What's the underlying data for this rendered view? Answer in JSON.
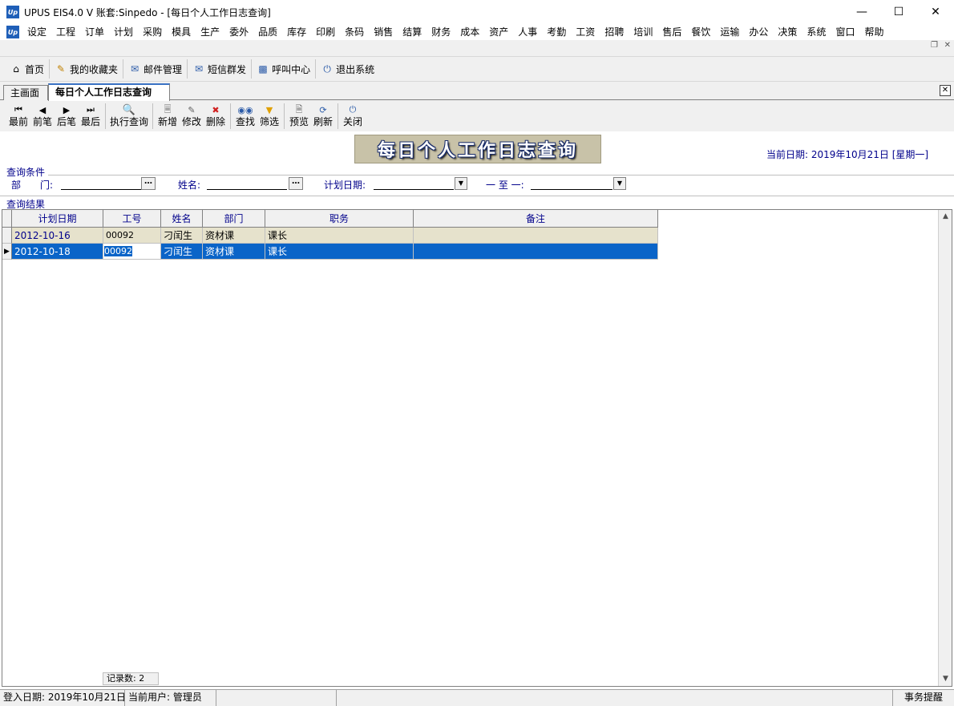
{
  "window": {
    "title": "UPUS EIS4.0 V 账套:Sinpedo - [每日个人工作日志查询]",
    "app_icon_text": "Up"
  },
  "menu": [
    "设定",
    "工程",
    "订单",
    "计划",
    "采购",
    "模具",
    "生产",
    "委外",
    "品质",
    "库存",
    "印刷",
    "条码",
    "销售",
    "结算",
    "财务",
    "成本",
    "资产",
    "人事",
    "考勤",
    "工资",
    "招聘",
    "培训",
    "售后",
    "餐饮",
    "运输",
    "办公",
    "决策",
    "系统",
    "窗口",
    "帮助"
  ],
  "quickbar": [
    {
      "label": "首页",
      "icon": "home-icon"
    },
    {
      "label": "我的收藏夹",
      "icon": "favorites-icon"
    },
    {
      "label": "邮件管理",
      "icon": "mail-icon"
    },
    {
      "label": "短信群发",
      "icon": "sms-icon"
    },
    {
      "label": "呼叫中心",
      "icon": "chat-icon"
    },
    {
      "label": "退出系统",
      "icon": "power-icon"
    }
  ],
  "tabs": [
    {
      "label": "主画面",
      "active": false
    },
    {
      "label": "每日个人工作日志查询",
      "active": true
    }
  ],
  "toolbar": [
    {
      "label": "最前",
      "icon": "first-icon"
    },
    {
      "label": "前笔",
      "icon": "prev-icon"
    },
    {
      "label": "后笔",
      "icon": "next-icon"
    },
    {
      "label": "最后",
      "icon": "last-icon"
    },
    {
      "label": "执行查询",
      "icon": "search-icon"
    },
    {
      "label": "新增",
      "icon": "new-icon"
    },
    {
      "label": "修改",
      "icon": "edit-icon"
    },
    {
      "label": "删除",
      "icon": "delete-icon"
    },
    {
      "label": "查找",
      "icon": "binoculars-icon"
    },
    {
      "label": "筛选",
      "icon": "filter-icon"
    },
    {
      "label": "预览",
      "icon": "preview-icon"
    },
    {
      "label": "刷新",
      "icon": "refresh-icon"
    },
    {
      "label": "关闭",
      "icon": "power-icon"
    }
  ],
  "page": {
    "title": "每日个人工作日志查询",
    "current_date_label": "当前日期: 2019年10月21日 [星期一]"
  },
  "query": {
    "group_label": "查询条件",
    "dept_label": "部　　门:",
    "dept_value": "",
    "name_label": "姓名:",
    "name_value": "",
    "plan_date_label": "计划日期:",
    "plan_date_from": "",
    "to_label": "一 至 一:",
    "plan_date_to": ""
  },
  "results": {
    "group_label": "查询结果",
    "columns": [
      "计划日期",
      "工号",
      "姓名",
      "部门",
      "职务",
      "备注"
    ],
    "rows": [
      [
        "2012-10-16",
        "00092",
        "刁闰生",
        "资材课",
        "课长",
        ""
      ],
      [
        "2012-10-18",
        "00092",
        "刁闰生",
        "资材课",
        "课长",
        ""
      ]
    ],
    "selected_row": 1,
    "record_count_label": "记录数: 2"
  },
  "statusbar": {
    "login_date": "登入日期: 2019年10月21日",
    "current_user": "当前用户: 管理员",
    "reminder": "事务提醒"
  }
}
